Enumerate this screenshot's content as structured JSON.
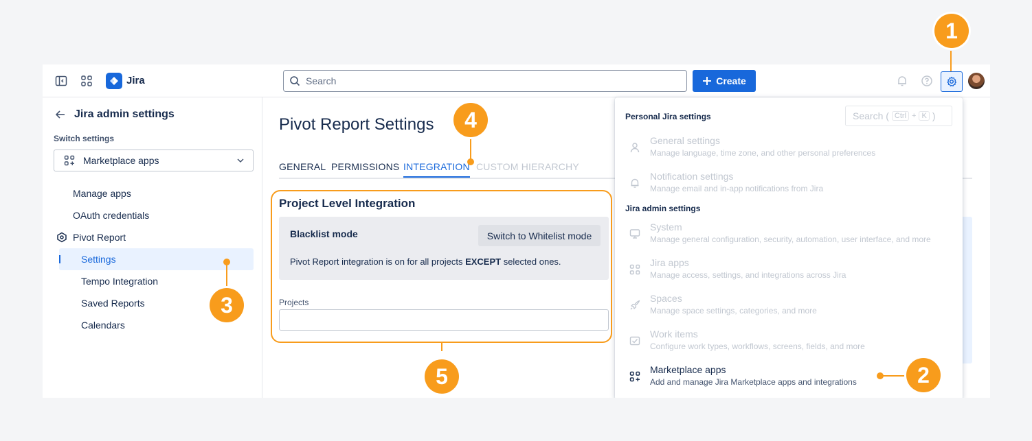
{
  "app": {
    "brand": "Jira"
  },
  "header": {
    "search_placeholder": "Search",
    "create_label": "Create"
  },
  "sidebar": {
    "back_title": "Jira admin settings",
    "switch_label": "Switch settings",
    "select_value": "Marketplace apps",
    "items": [
      {
        "label": "Manage apps"
      },
      {
        "label": "OAuth credentials"
      },
      {
        "label": "Pivot Report"
      },
      {
        "label": "Settings"
      },
      {
        "label": "Tempo Integration"
      },
      {
        "label": "Saved Reports"
      },
      {
        "label": "Calendars"
      }
    ]
  },
  "main": {
    "title": "Pivot Report Settings",
    "tabs": [
      {
        "label": "GENERAL"
      },
      {
        "label": "PERMISSIONS"
      },
      {
        "label": "INTEGRATION"
      },
      {
        "label": "CUSTOM HIERARCHY"
      }
    ],
    "section_title": "Project Level Integration",
    "mode_label": "Blacklist mode",
    "switch_button": "Switch to Whitelist mode",
    "desc_before": "Pivot Report integration is on for all projects ",
    "desc_bold": "EXCEPT",
    "desc_after": " selected ones.",
    "projects_label": "Projects"
  },
  "dropdown": {
    "personal_heading": "Personal Jira settings",
    "search_label": "Search (",
    "search_close": ")",
    "kbd_ctrl": "Ctrl",
    "kbd_plus": "+",
    "kbd_k": "K",
    "personal_items": [
      {
        "title": "General settings",
        "desc": "Manage language, time zone, and other personal preferences"
      },
      {
        "title": "Notification settings",
        "desc": "Manage email and in-app notifications from Jira"
      }
    ],
    "admin_heading": "Jira admin settings",
    "admin_items": [
      {
        "title": "System",
        "desc": "Manage general configuration, security, automation, user interface, and more"
      },
      {
        "title": "Jira apps",
        "desc": "Manage access, settings, and integrations across Jira"
      },
      {
        "title": "Spaces",
        "desc": "Manage space settings, categories, and more"
      },
      {
        "title": "Work items",
        "desc": "Configure work types, workflows, screens, fields, and more"
      },
      {
        "title": "Marketplace apps",
        "desc": "Add and manage Jira Marketplace apps and integrations"
      }
    ]
  },
  "callouts": [
    "1",
    "2",
    "3",
    "4",
    "5"
  ],
  "colors": {
    "accent": "#1868db",
    "callout": "#f89c1c",
    "active_bg": "#e9f2ff"
  }
}
